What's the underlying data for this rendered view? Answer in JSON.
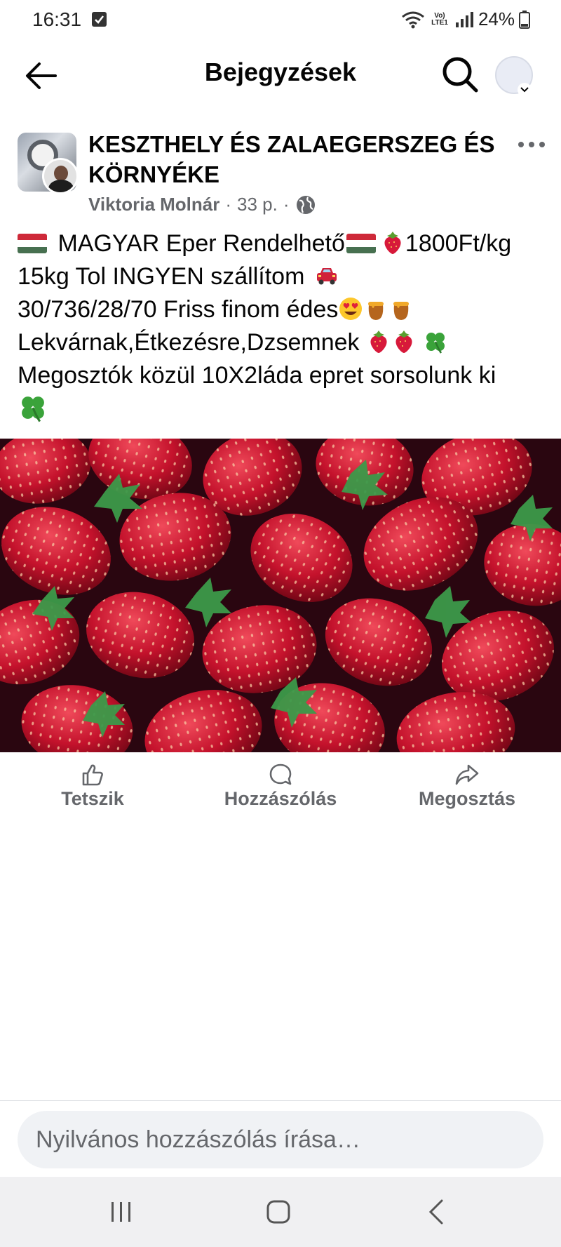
{
  "status_bar": {
    "time": "16:31",
    "battery": "24%",
    "network_label": "Vo) LTE1"
  },
  "header": {
    "title": "Bejegyzések"
  },
  "post": {
    "group_name": "KESZTHELY ÉS ZALAEGERSZEG ÉS KÖRNYÉKE",
    "author": "Viktoria Molnár",
    "time_ago": "33 p.",
    "separator": "·",
    "text_lines": [
      [
        "MAGYAR Eper Rendelhető",
        "1800Ft/kg"
      ],
      [
        "15kg Tol INGYEN szállítom"
      ],
      [
        "30/736/28/70 Friss finom édes"
      ],
      [
        "Lekvárnak,Étkezésre,Dzsemnek"
      ],
      [
        "Megosztók közül 10X2láda epret sorsolunk ki"
      ]
    ],
    "photo_subject": "strawberries"
  },
  "actions": {
    "like": "Tetszik",
    "comment": "Hozzászólás",
    "share": "Megosztás"
  },
  "comment_bar": {
    "placeholder": "Nyilvános hozzászólás írása…"
  },
  "colors": {
    "secondary_text": "#65676b",
    "input_bg": "#f0f2f5",
    "strawberry_red": "#c8102e"
  }
}
